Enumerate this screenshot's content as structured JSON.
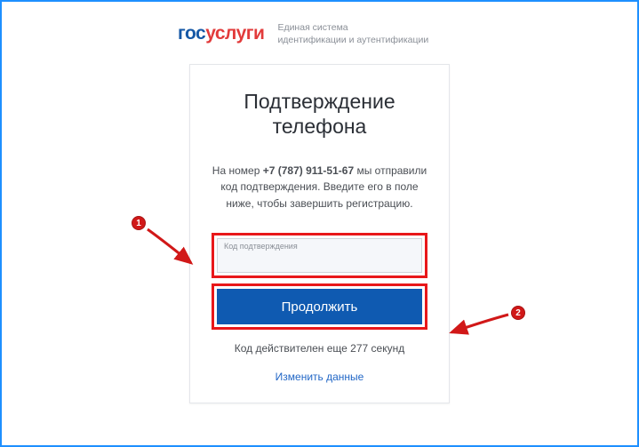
{
  "logo": {
    "part1": "гос",
    "part2": "услуги"
  },
  "tagline": {
    "line1": "Единая система",
    "line2": "идентификации и аутентификации"
  },
  "title": {
    "line1": "Подтверждение",
    "line2": "телефона"
  },
  "message": {
    "prefix": "На номер ",
    "phone": "+7 (787) 911-51-67",
    "suffix": " мы отправили код подтверждения. Введите его в поле ниже, чтобы завершить регистрацию."
  },
  "input": {
    "label": "Код подтверждения",
    "value": ""
  },
  "button": {
    "label": "Продолжить"
  },
  "timer": {
    "prefix": "Код действителен еще ",
    "seconds": "277",
    "suffix": " секунд"
  },
  "change_link": "Изменить данные",
  "annotations": {
    "badge1": "1",
    "badge2": "2"
  },
  "colors": {
    "accent_blue": "#0f5ab1",
    "highlight_red": "#e8171a",
    "logo_blue": "#1658a6",
    "logo_red": "#e23b3b"
  }
}
